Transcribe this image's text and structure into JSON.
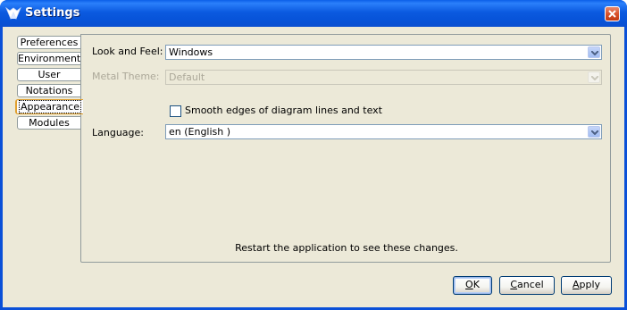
{
  "window": {
    "title": "Settings"
  },
  "tabs": [
    {
      "label": "Preferences",
      "selected": false
    },
    {
      "label": "Environment",
      "selected": false
    },
    {
      "label": "User",
      "selected": false
    },
    {
      "label": "Notations",
      "selected": false
    },
    {
      "label": "Appearance",
      "selected": true
    },
    {
      "label": "Modules",
      "selected": false
    }
  ],
  "appearance": {
    "look_and_feel": {
      "label": "Look and Feel:",
      "value": "Windows"
    },
    "metal_theme": {
      "label": "Metal Theme:",
      "value": "Default",
      "enabled": false
    },
    "smooth_edges": {
      "label": "Smooth edges of diagram lines and text",
      "checked": false
    },
    "language": {
      "label": "Language:",
      "value": "en (English )"
    },
    "restart_note": "Restart the application to see these changes."
  },
  "buttons": {
    "ok": {
      "mnemonic": "O",
      "rest": "K"
    },
    "cancel": {
      "mnemonic": "C",
      "rest": "ancel"
    },
    "apply": {
      "mnemonic": "A",
      "rest": "pply"
    }
  },
  "colors": {
    "titlebar": "#0a5ee8",
    "dialog_background": "#ece9d8",
    "close_button": "#d9532c"
  },
  "icons": [
    "app-logo-icon",
    "close-icon",
    "dropdown-arrow-icon"
  ]
}
